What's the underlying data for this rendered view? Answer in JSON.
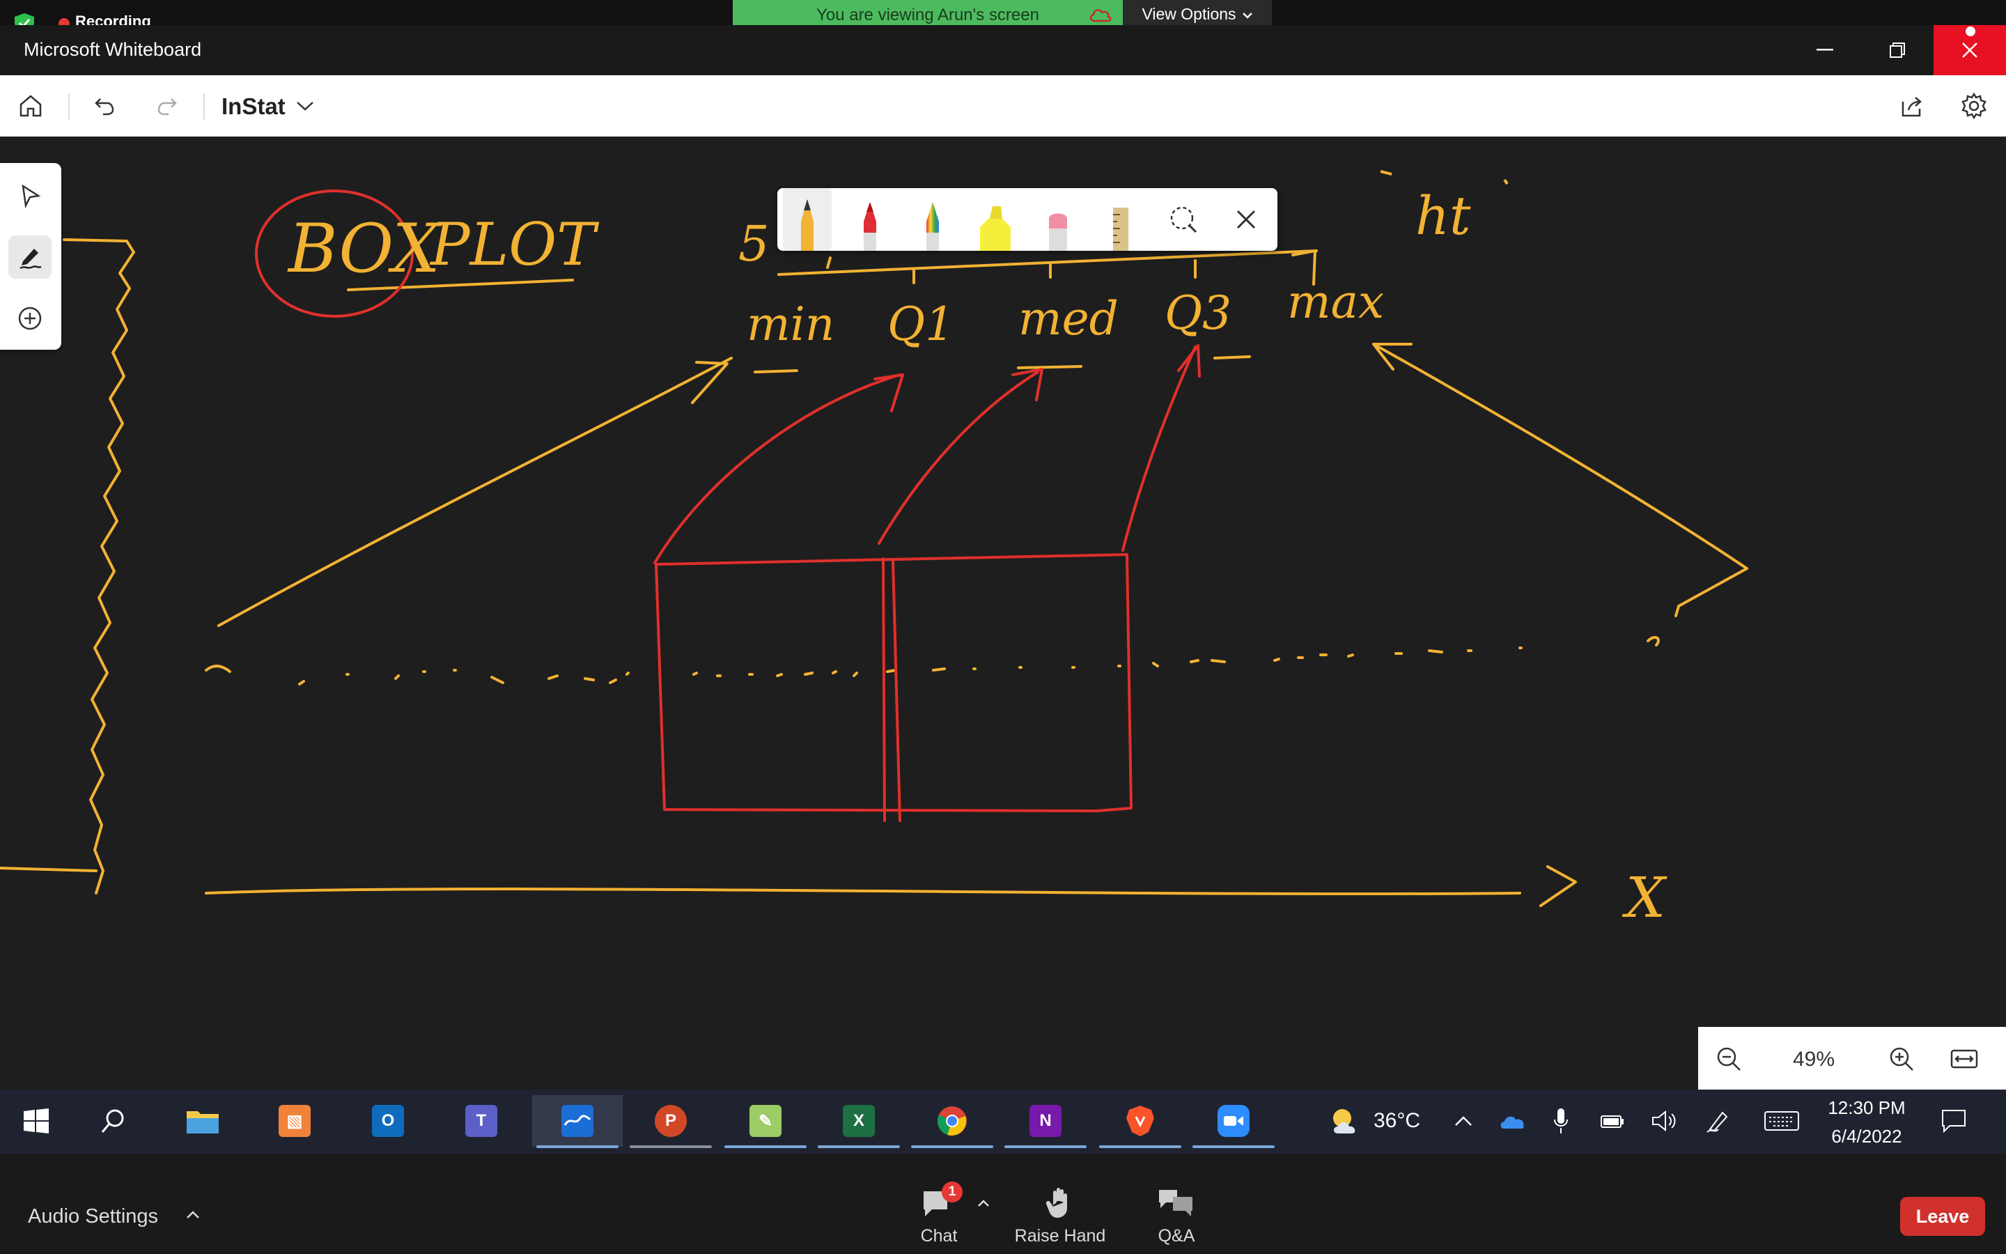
{
  "zoom_top": {
    "recording_label": "Recording",
    "viewing_banner": "You are viewing Arun's screen",
    "view_options_label": "View Options"
  },
  "window": {
    "title": "Microsoft Whiteboard"
  },
  "toolbar": {
    "board_name": "InStat",
    "icons": [
      "home-icon",
      "undo-icon",
      "redo-icon",
      "chevron-down-icon",
      "share-icon",
      "gear-icon"
    ]
  },
  "left_rail": {
    "tools": [
      "select-arrow-icon",
      "pen-ink-icon",
      "add-icon"
    ]
  },
  "pen_tray": {
    "tools": [
      "pen-yellow",
      "pen-red",
      "pen-rainbow",
      "highlighter-yellow",
      "eraser",
      "ruler",
      "lasso-select",
      "close"
    ]
  },
  "whiteboard": {
    "title_box": "BOX",
    "title_rest": "PLOT",
    "labels": {
      "five": "5",
      "min": "min",
      "q1": "Q1",
      "med": "med",
      "q3": "Q3",
      "max": "max",
      "ht": "ht",
      "x_axis": "X"
    },
    "ink_colors": {
      "yellow": "#f2b233",
      "red": "#e0302c"
    }
  },
  "zoom_panel": {
    "zoom_value": "49%"
  },
  "taskbar": {
    "apps": [
      {
        "name": "windows-start",
        "label": ""
      },
      {
        "name": "search",
        "label": ""
      },
      {
        "name": "file-explorer",
        "label": ""
      },
      {
        "name": "app-orange",
        "label": ""
      },
      {
        "name": "outlook",
        "label": "O"
      },
      {
        "name": "teams",
        "label": "T"
      },
      {
        "name": "whiteboard",
        "label": ""
      },
      {
        "name": "powerpoint",
        "label": "P"
      },
      {
        "name": "photo-editor",
        "label": ""
      },
      {
        "name": "excel",
        "label": "X"
      },
      {
        "name": "chrome",
        "label": ""
      },
      {
        "name": "onenote",
        "label": "N"
      },
      {
        "name": "brave",
        "label": ""
      },
      {
        "name": "zoom",
        "label": ""
      }
    ],
    "temperature": "36°C",
    "time": "12:30 PM",
    "date": "6/4/2022"
  },
  "zoom_bottom": {
    "audio_settings": "Audio Settings",
    "chat_label": "Chat",
    "chat_badge": "1",
    "raise_hand_label": "Raise Hand",
    "qa_label": "Q&A",
    "leave_label": "Leave"
  }
}
